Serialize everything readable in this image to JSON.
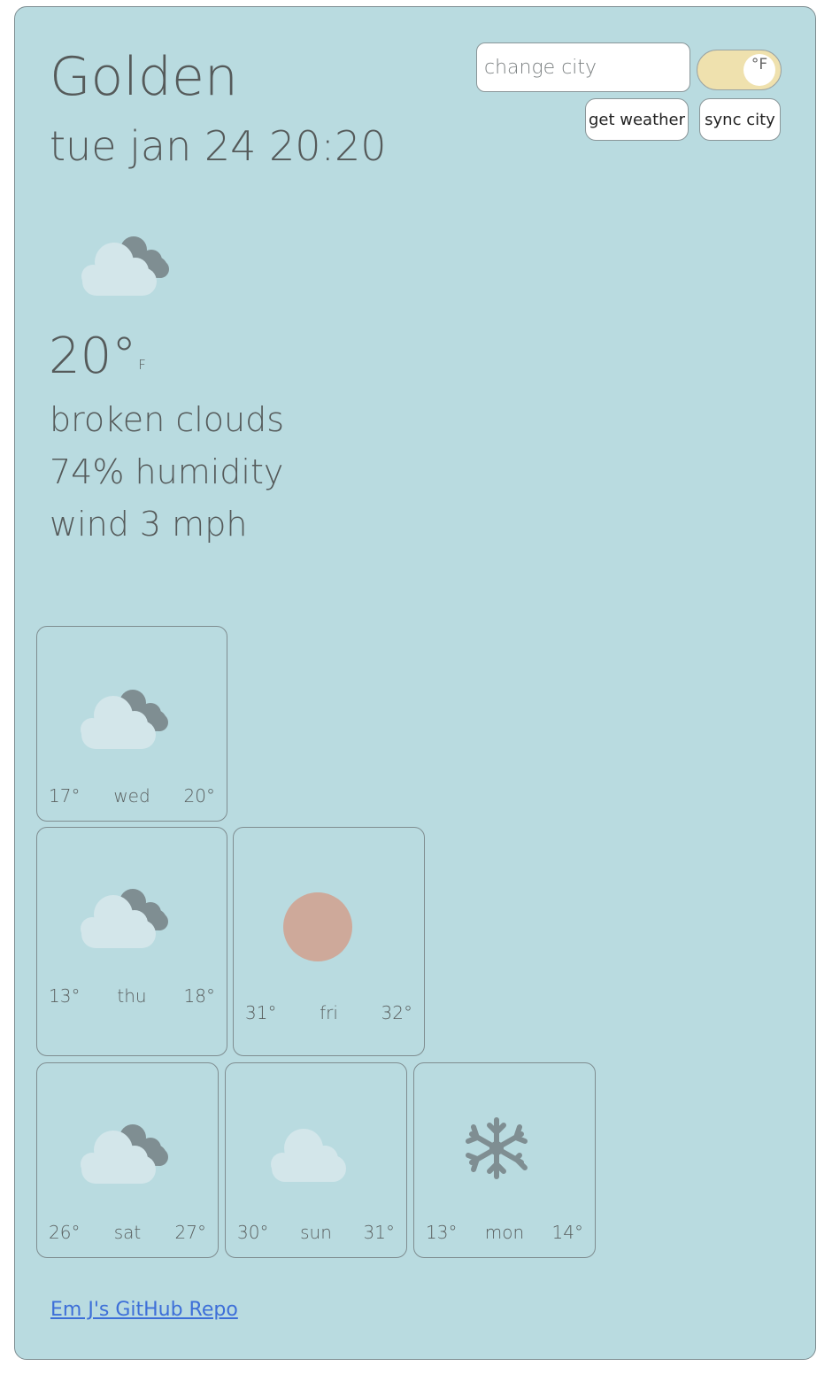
{
  "location": {
    "city": "Golden",
    "datetime": "tue jan 24 20:20"
  },
  "controls": {
    "search_placeholder": "change city",
    "unit_toggle_label": "°F",
    "get_weather_label": "get weather",
    "sync_city_label": "sync city"
  },
  "current": {
    "icon": "broken-clouds-icon",
    "temperature": "20°",
    "unit": "F",
    "description": "broken clouds",
    "humidity": "74% humidity",
    "wind": "wind 3 mph"
  },
  "forecast": [
    {
      "day": "wed",
      "low": "17°",
      "high": "20°",
      "icon": "broken-clouds-icon"
    },
    {
      "day": "thu",
      "low": "13°",
      "high": "18°",
      "icon": "broken-clouds-icon"
    },
    {
      "day": "fri",
      "low": "31°",
      "high": "32°",
      "icon": "sun-icon"
    },
    {
      "day": "sat",
      "low": "26°",
      "high": "27°",
      "icon": "broken-clouds-icon"
    },
    {
      "day": "sun",
      "low": "30°",
      "high": "31°",
      "icon": "cloud-icon"
    },
    {
      "day": "mon",
      "low": "13°",
      "high": "14°",
      "icon": "snowflake-icon"
    }
  ],
  "footer": {
    "link_text": "Em J's GitHub Repo"
  },
  "colors": {
    "background": "#b9dbe0",
    "toggle": "#efe1ae",
    "sun": "#cea99a",
    "cloud_light": "#d3e6ea",
    "cloud_dark": "#7c8c90",
    "link": "#3d6fd8"
  }
}
